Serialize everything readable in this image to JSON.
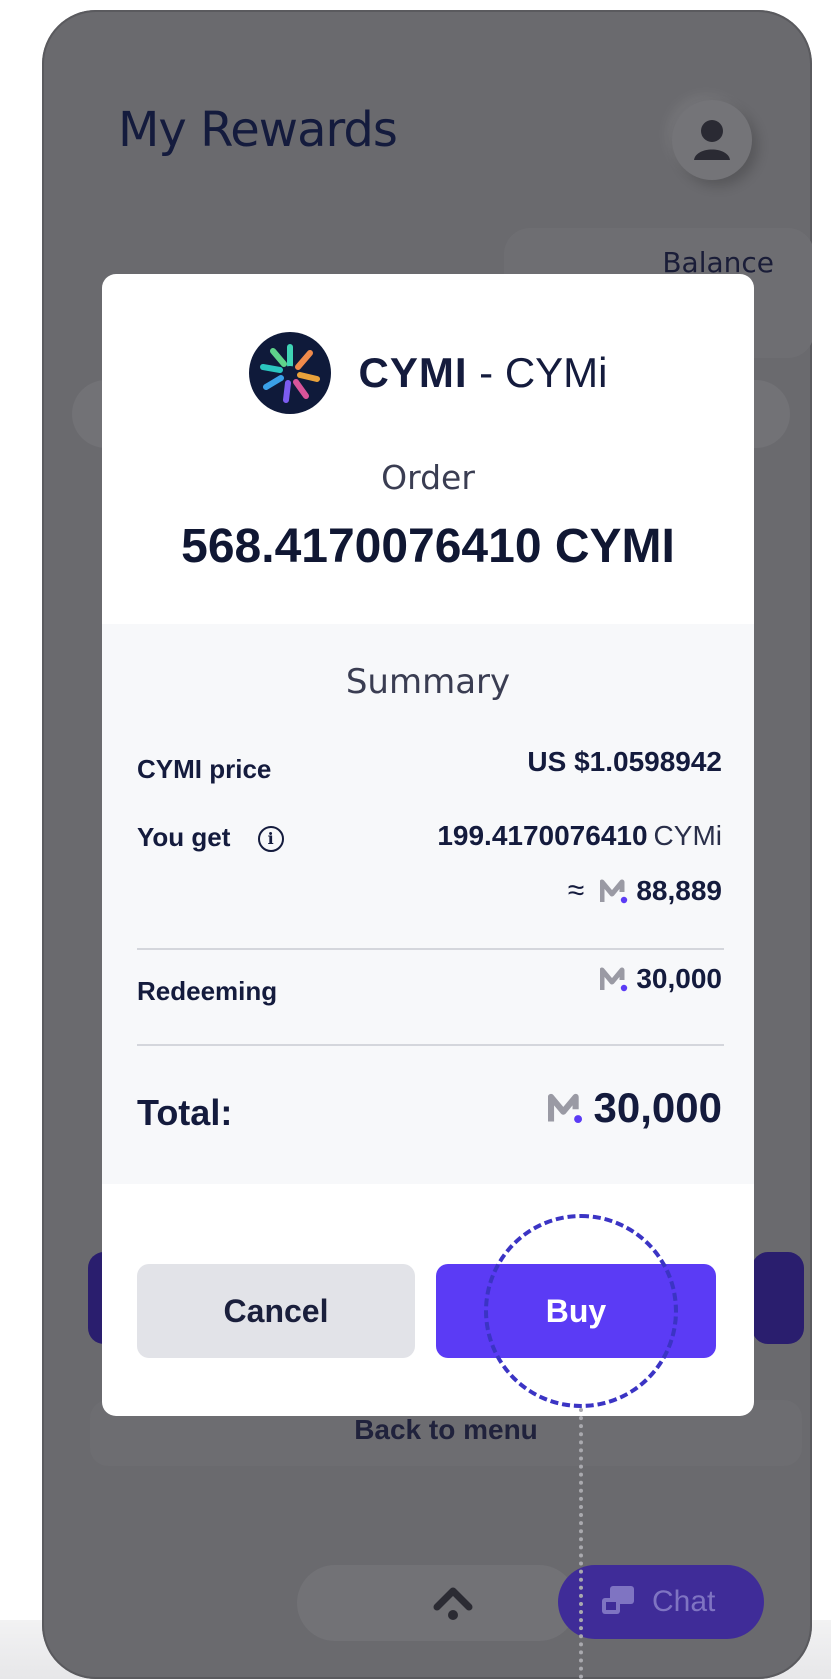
{
  "app": {
    "title": "My Rewards",
    "balance_label": "Balance",
    "back_to_menu": "Back to menu",
    "chat_label": "Chat"
  },
  "modal": {
    "token_symbol": "CYMI",
    "token_separator": " - ",
    "token_name": "CYMi",
    "order_label": "Order",
    "order_amount": "568.4170076410 CYMI",
    "summary": {
      "title": "Summary",
      "price_label": "CYMI price",
      "price_value": "US $1.0598942",
      "you_get_label": "You get",
      "info_icon": "i",
      "you_get_amount": "199.4170076410",
      "you_get_unit": "CYMi",
      "approx_symbol": "≈",
      "you_get_points": "88,889",
      "redeeming_label": "Redeeming",
      "redeeming_points": "30,000",
      "total_label": "Total:",
      "total_points": "30,000"
    },
    "cancel_label": "Cancel",
    "buy_label": "Buy"
  },
  "colors": {
    "accent": "#5b3bf5",
    "overlay": "#6a6a6e",
    "text_dark": "#141b3d",
    "tap_indicator": "#3b34c4"
  },
  "icons": {
    "avatar": "person-icon",
    "token": "cymi-token-icon",
    "points": "m-points-icon",
    "home": "chevron-up-icon",
    "chat": "chat-icon"
  }
}
